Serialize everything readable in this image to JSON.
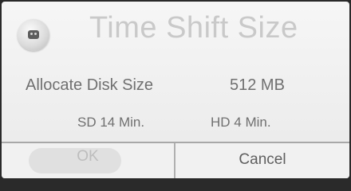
{
  "dialog": {
    "title": "Time Shift Size",
    "logo_icon": "tv-mascot-icon"
  },
  "setting": {
    "label": "Allocate Disk Size",
    "value": "512 MB"
  },
  "estimates": {
    "sd": "SD 14 Min.",
    "hd": "HD 4 Min."
  },
  "buttons": {
    "ok_label": "OK",
    "cancel_label": "Cancel"
  }
}
